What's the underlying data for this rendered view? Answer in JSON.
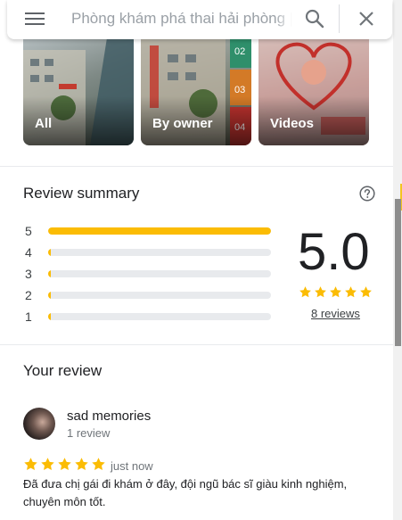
{
  "search": {
    "query": "Phòng khám phá thai hải phòng |"
  },
  "photos": [
    {
      "label": "All"
    },
    {
      "label": "By owner"
    },
    {
      "label": "Videos"
    }
  ],
  "review_summary": {
    "title": "Review summary",
    "rows": [
      {
        "stars": "5",
        "fraction": 1.0
      },
      {
        "stars": "4",
        "fraction": 0
      },
      {
        "stars": "3",
        "fraction": 0
      },
      {
        "stars": "2",
        "fraction": 0
      },
      {
        "stars": "1",
        "fraction": 0
      }
    ],
    "score": "5.0",
    "stars": 5,
    "reviews_link": "8 reviews"
  },
  "your_review": {
    "title": "Your review",
    "author": "sad memories",
    "author_reviews": "1 review",
    "stars": 5,
    "when": "just now",
    "text": "Đã đưa chị gái đi khám ở đây, đội ngũ bác sĩ giàu kinh nghiệm, chuyên môn tốt."
  },
  "colors": {
    "star": "#fbbc04",
    "bar_track": "#e8eaed"
  },
  "icons": [
    "menu-icon",
    "search-icon",
    "close-icon",
    "help-icon",
    "star-icon"
  ]
}
